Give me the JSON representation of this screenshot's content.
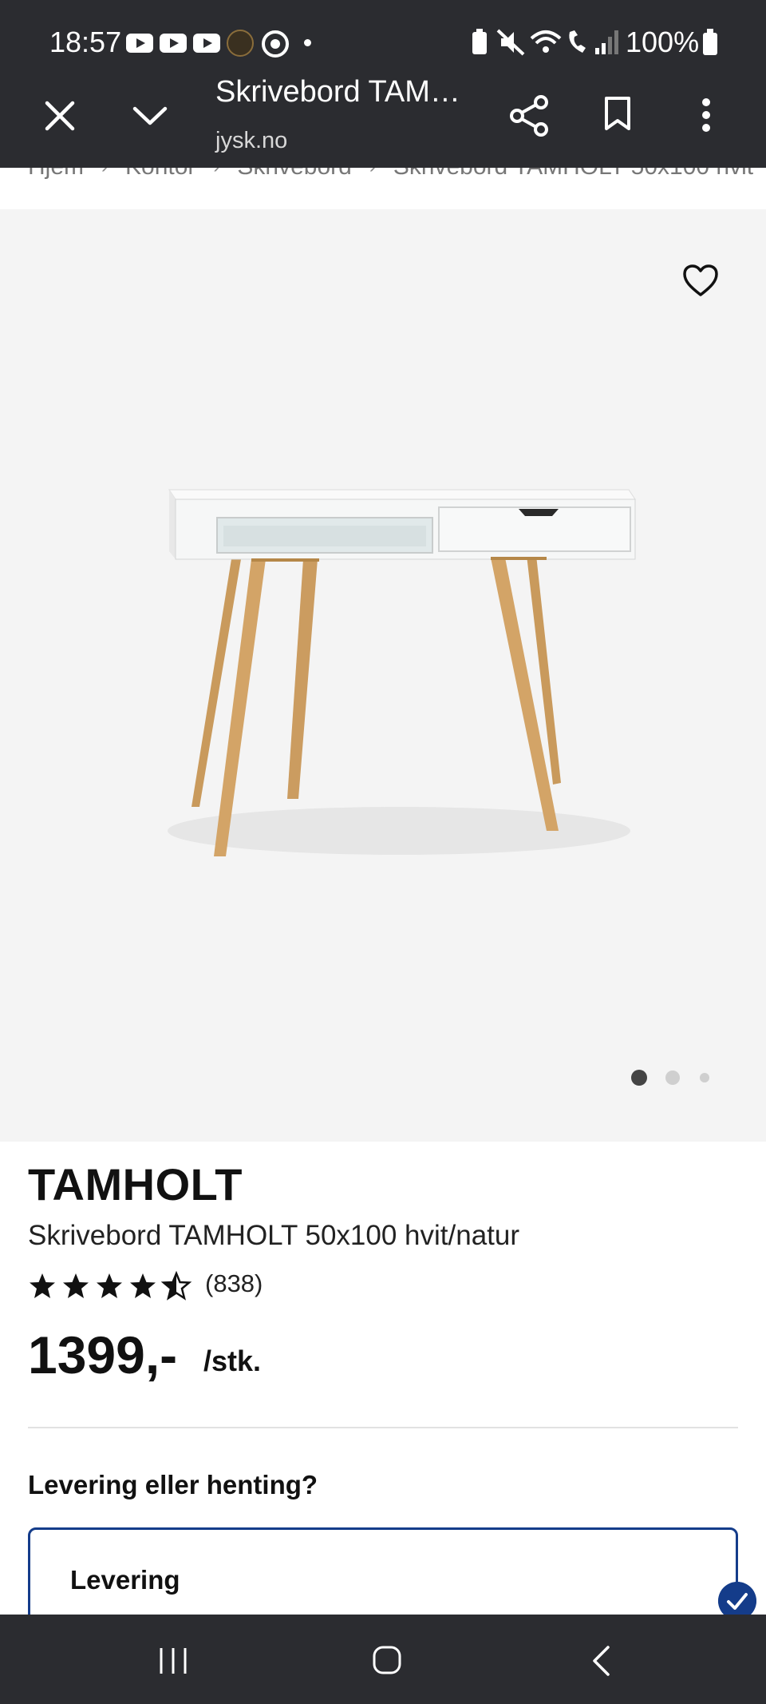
{
  "status_bar": {
    "time": "18:57",
    "battery": "100%"
  },
  "toolbar": {
    "title": "Skrivebord TAM…",
    "url": "jysk.no",
    "close_icon": "close-icon",
    "collapse_icon": "chevron-down-icon",
    "share_icon": "share-icon",
    "bookmark_icon": "bookmark-icon",
    "menu_icon": "more-vert-icon"
  },
  "breadcrumb": [
    "Hjem",
    "Kontor",
    "Skrivebord",
    "Skrivebord TAMHOLT 50x100 hvit"
  ],
  "gallery": {
    "image_count": 3,
    "active_index": 0,
    "favorite_icon": "heart-icon"
  },
  "product": {
    "brand": "TAMHOLT",
    "name": "Skrivebord TAMHOLT 50x100 hvit/natur",
    "rating": 4.5,
    "review_count": "(838)",
    "price": "1399,-",
    "unit": "/stk."
  },
  "delivery": {
    "question": "Levering eller henting?",
    "option_label": "Levering",
    "selected": true
  },
  "colors": {
    "toolbar_bg": "#2b2c30",
    "accent": "#143c8a",
    "gallery_bg": "#f4f4f4"
  }
}
